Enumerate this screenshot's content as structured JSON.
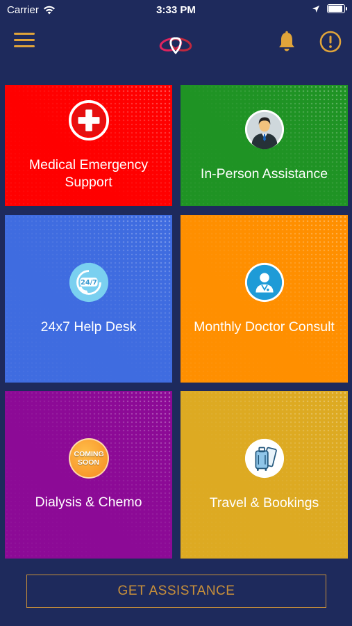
{
  "status_bar": {
    "carrier": "Carrier",
    "time": "3:33 PM"
  },
  "colors": {
    "background": "#1e2a5c",
    "accent": "#e0a43a"
  },
  "nav": {
    "menu_icon": "hamburger-menu-icon",
    "logo_icon": "heart-location-logo",
    "notification_icon": "bell-icon",
    "alert_icon": "exclamation-circle-icon"
  },
  "tiles": [
    {
      "label": "Medical Emergency Support",
      "color": "#ff0000",
      "icon": "medical-cross-icon"
    },
    {
      "label": "In-Person Assistance",
      "color": "#1f9324",
      "icon": "person-avatar-icon"
    },
    {
      "label": "24x7 Help Desk",
      "color": "#3f6ce0",
      "icon": "help-desk-24-7-icon"
    },
    {
      "label": "Monthly Doctor Consult",
      "color": "#ff8f00",
      "icon": "doctor-icon"
    },
    {
      "label": "Dialysis & Chemo",
      "color": "#8c0a96",
      "icon": "coming-soon-badge",
      "badge_text": "COMING SOON"
    },
    {
      "label": "Travel & Bookings",
      "color": "#ddaa22",
      "icon": "luggage-ticket-icon"
    }
  ],
  "cta": {
    "label": "GET ASSISTANCE"
  }
}
